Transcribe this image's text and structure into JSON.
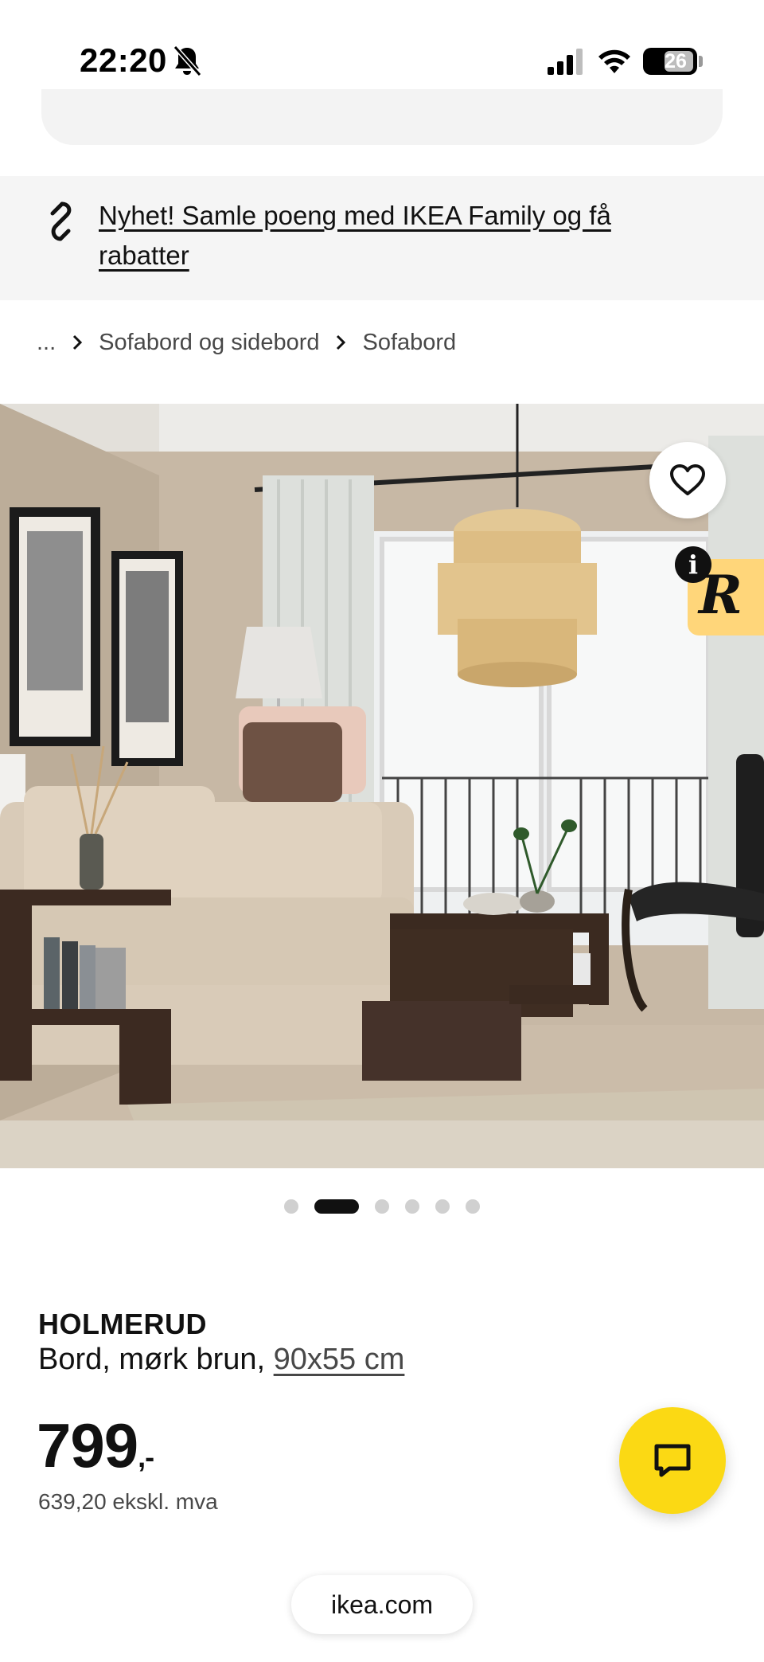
{
  "status_bar": {
    "time": "22:20",
    "battery": "26",
    "icons": [
      "bell-slash-icon",
      "signal-icon",
      "wifi-icon",
      "battery-icon"
    ]
  },
  "banner": {
    "text": "Nyhet! Samle poeng med IKEA Family og få rabatter",
    "icon": "ikea-family-icon"
  },
  "breadcrumb": {
    "items": [
      "...",
      "Sofabord og sidebord",
      "Sofabord"
    ]
  },
  "gallery": {
    "image_count": 6,
    "active_index": 1,
    "favorite_icon": "heart-icon",
    "extension_icon": "R",
    "info_icon": "i"
  },
  "product": {
    "name": "HOLMERUD",
    "description": "Bord, mørk brun, ",
    "size": "90x55 cm",
    "price": "799",
    "price_suffix": ",-",
    "price_excl_vat": "639,20 ekskl. mva"
  },
  "chat": {
    "icon": "chat-bubble-icon"
  },
  "browser": {
    "url": "ikea.com"
  },
  "colors": {
    "chat_button": "#fbd914",
    "banner_bg": "#f5f5f5",
    "extension_badge": "#ffd67a"
  }
}
